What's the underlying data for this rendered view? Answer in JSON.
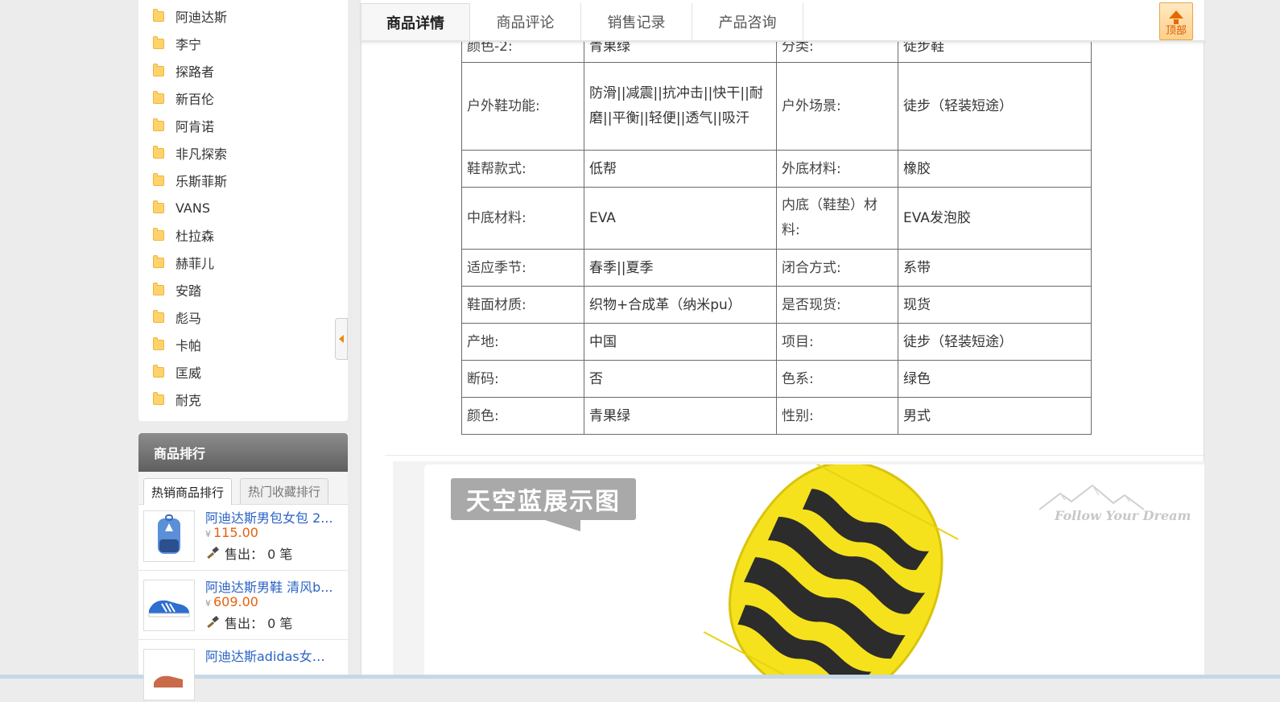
{
  "sidebar": {
    "brands": [
      "阿迪达斯",
      "李宁",
      "探路者",
      "新百伦",
      "阿肯诺",
      "非凡探索",
      "乐斯菲斯",
      "VANS",
      "杜拉森",
      "赫菲儿",
      "安踏",
      "彪马",
      "卡帕",
      "匡威",
      "耐克"
    ],
    "ranking": {
      "title": "商品排行",
      "tabs": [
        "热销商品排行",
        "热门收藏排行"
      ],
      "sold_label": "售出：",
      "items": [
        {
          "title": "阿迪达斯男包女包 2...",
          "currency": "¥",
          "price": "115.00",
          "sold": "0 笔"
        },
        {
          "title": "阿迪达斯男鞋 清风b...",
          "currency": "¥",
          "price": "609.00",
          "sold": "0 笔"
        },
        {
          "title": "阿迪达斯adidas女鞋..."
        }
      ]
    }
  },
  "tabs": [
    "商品详情",
    "商品评论",
    "销售记录",
    "产品咨询"
  ],
  "back_to_top": "顶部",
  "spec_rows": [
    [
      "颜色-2:",
      "青果绿",
      "分类:",
      "徒步鞋"
    ],
    [
      "户外鞋功能:",
      "防滑||减震||抗冲击||快干||耐磨||平衡||轻便||透气||吸汗",
      "户外场景:",
      "徒步（轻装短途）"
    ],
    [
      "鞋帮款式:",
      "低帮",
      "外底材料:",
      "橡胶"
    ],
    [
      "中底材料:",
      "EVA",
      "内底（鞋垫）材料:",
      "EVA发泡胶"
    ],
    [
      "适应季节:",
      "春季||夏季",
      "闭合方式:",
      "系带"
    ],
    [
      "鞋面材质:",
      "织物+合成革（纳米pu）",
      "是否现货:",
      "现货"
    ],
    [
      "产地:",
      "中国",
      "项目:",
      "徒步（轻装短途）"
    ],
    [
      "断码:",
      "否",
      "色系:",
      "绿色"
    ],
    [
      "颜色:",
      "青果绿",
      "性别:",
      "男式"
    ]
  ],
  "promo": {
    "label": "天空蓝展示图",
    "slogan": "Follow Your Dream"
  },
  "colors": {
    "price": "#e8600c",
    "link": "#2a63c6",
    "sole_yellow": "#f5e21c",
    "sole_black": "#2c2c2c"
  }
}
